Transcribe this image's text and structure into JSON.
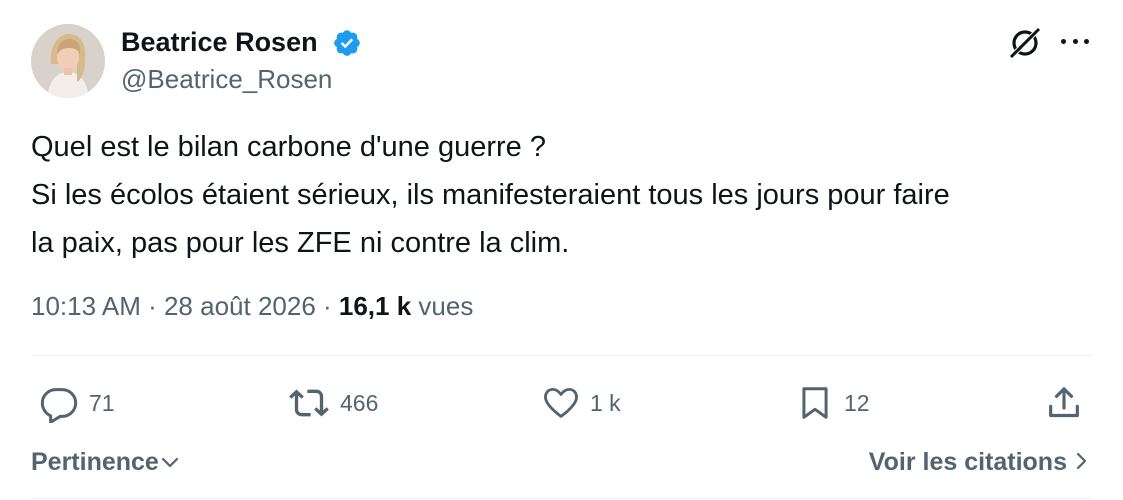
{
  "author": {
    "name": "Beatrice Rosen",
    "handle": "@Beatrice_Rosen",
    "verified": true
  },
  "tweet": {
    "lines": [
      "Quel est le bilan carbone d'une guerre ?",
      "Si les écolos étaient sérieux, ils manifesteraient tous les jours pour faire",
      "la paix, pas pour les ZFE ni contre la clim."
    ]
  },
  "meta": {
    "time": "10:13 AM",
    "separator": " · ",
    "date": "28 août 2026",
    "views_count": "16,1 k",
    "views_label": "vues"
  },
  "actions": {
    "replies": "71",
    "retweets": "466",
    "likes": "1 k",
    "bookmarks": "12"
  },
  "footer": {
    "sort_label": "Pertinence",
    "quotes_label": "Voir les citations"
  },
  "icons": {
    "verified": "verified-badge-icon",
    "grok": "grok-icon",
    "more": "more-icon",
    "reply": "reply-icon",
    "retweet": "retweet-icon",
    "like": "heart-icon",
    "bookmark": "bookmark-icon",
    "share": "share-icon",
    "sort": "chevron-down-icon",
    "quotes": "chevron-right-icon"
  },
  "colors": {
    "text_primary": "#0f1419",
    "text_secondary": "#536471",
    "verified_blue": "#1d9bf0",
    "divider": "#eff3f4"
  }
}
